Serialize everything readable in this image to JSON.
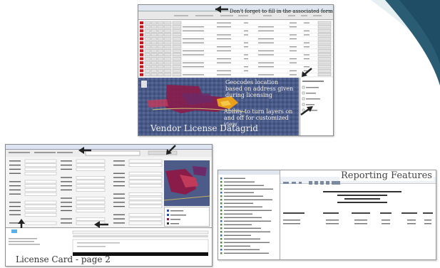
{
  "slide": {
    "accent_color": "#1f4d66",
    "shot1": {
      "callout_top": "Don't forget to fill in the associated forms",
      "callout_mid": "Geocodes location based on address given during licensing",
      "callout_low": "Ability to turn layers on and off for customized view",
      "title": "Vendor License Datagrid",
      "grid_rows": 14,
      "row_id_color": "#c8141c"
    },
    "shot2": {
      "title": "License Card - page 2",
      "map_colors": [
        "#8a1c4a",
        "#6b2a6a",
        "#c23a5a"
      ]
    },
    "shot3": {
      "title": "Reporting Features"
    }
  }
}
